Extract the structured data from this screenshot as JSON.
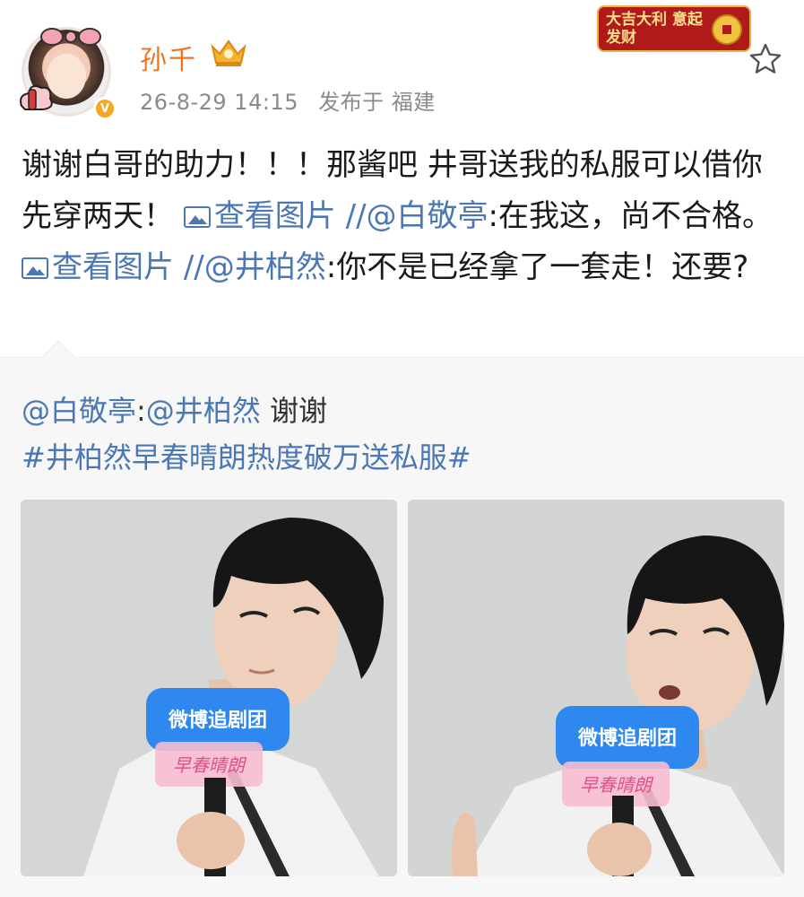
{
  "header": {
    "username": "孙千",
    "timestamp": "26-8-29 14:15",
    "location": "发布于 福建",
    "festive_badge_text": "大吉大利 意起发财",
    "verified_icon": "verified-v-icon",
    "vip_icon": "vip-crown-icon",
    "favorite_icon": "star-outline-icon"
  },
  "post": {
    "text_1": "谢谢白哥的助力！！！那酱吧 井哥送我的私服可以借你先穿两天！",
    "view_image_1": "查看图片",
    "mention_1": "//@白敬亭",
    "text_2": ":在我这，尚不合格。",
    "view_image_2": "查看图片",
    "mention_2": "//@井柏然",
    "text_3": ":你不是已经拿了一套走！还要?"
  },
  "repost": {
    "mention_a": "@白敬亭",
    "sep": ":",
    "mention_b": "@井柏然",
    "thanks": " 谢谢",
    "hashtag": "#井柏然早春晴朗热度破万送私服#",
    "images": [
      {
        "mic_text": "微博追剧团",
        "pink_text": "早春晴朗"
      },
      {
        "mic_text": "微博追剧团",
        "pink_text": "早春晴朗"
      }
    ]
  },
  "colors": {
    "username": "#f0731e",
    "link": "#4b77b4",
    "meta": "#8a8a8a",
    "repost_bg": "#f7f7f7"
  }
}
